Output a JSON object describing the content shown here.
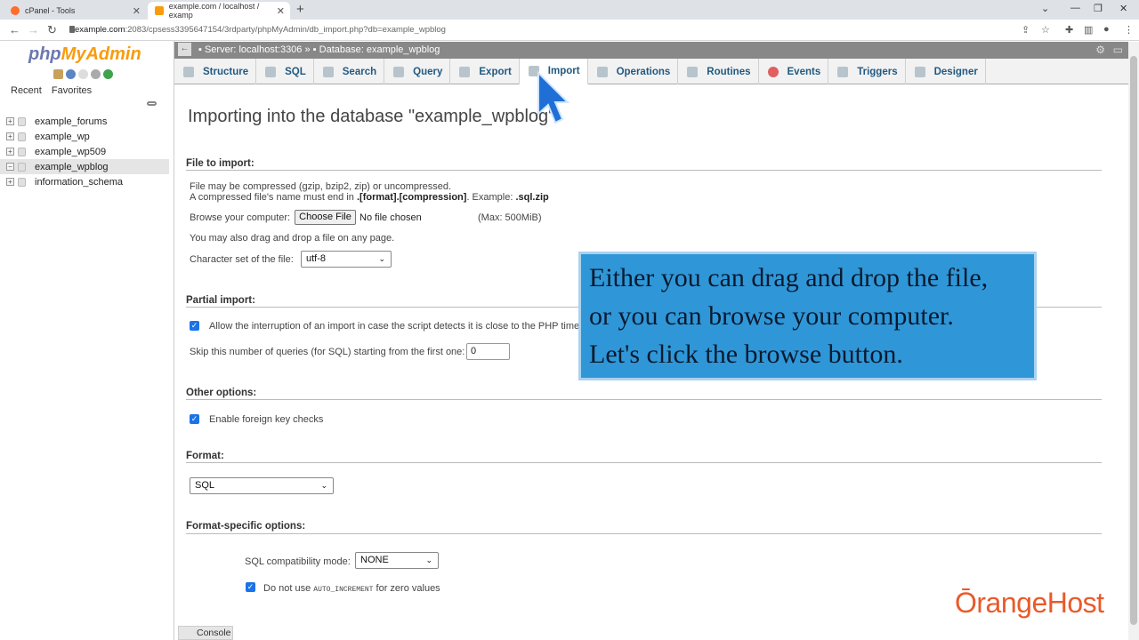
{
  "browser": {
    "tabs": [
      {
        "title": "cPanel - Tools"
      },
      {
        "title": "example.com / localhost / examp"
      }
    ],
    "url_host": "example.com",
    "url_rest": ":2083/cpsess3395647154/3rdparty/phpMyAdmin/db_import.php?db=example_wpblog"
  },
  "sidebar": {
    "logo_php": "php",
    "logo_my": "MyAdmin",
    "nav": [
      "Recent",
      "Favorites"
    ],
    "databases": [
      "example_forums",
      "example_wp",
      "example_wp509",
      "example_wpblog",
      "information_schema"
    ],
    "selected": "example_wpblog"
  },
  "breadcrumb": {
    "server": "Server: localhost:3306",
    "sep": "»",
    "database": "Database: example_wpblog"
  },
  "menu": {
    "tabs": [
      "Structure",
      "SQL",
      "Search",
      "Query",
      "Export",
      "Import",
      "Operations",
      "Routines",
      "Events",
      "Triggers",
      "Designer"
    ],
    "active": "Import"
  },
  "main": {
    "title": "Importing into the database \"example_wpblog\"",
    "file_section": {
      "heading": "File to import:",
      "line1": "File may be compressed (gzip, bzip2, zip) or uncompressed.",
      "line2_pre": "A compressed file's name must end in ",
      "line2_bold": ".[format].[compression]",
      "line2_mid": ". Example: ",
      "line2_example": ".sql.zip",
      "browse_label": "Browse your computer:",
      "choose_button": "Choose File",
      "no_file": "No file chosen",
      "max": "(Max: 500MiB)",
      "drag_hint": "You may also drag and drop a file on any page.",
      "charset_label": "Character set of the file:",
      "charset_value": "utf-8"
    },
    "partial_section": {
      "heading": "Partial import:",
      "allow_interrupt": "Allow the interruption of an import in case the script detects it is close to the PHP timeout",
      "skip_label": "Skip this number of queries (for SQL) starting from the first one:",
      "skip_value": "0"
    },
    "other_section": {
      "heading": "Other options:",
      "foreign_keys": "Enable foreign key checks"
    },
    "format_section": {
      "heading": "Format:",
      "value": "SQL"
    },
    "format_specific": {
      "heading": "Format-specific options:",
      "compat_label": "SQL compatibility mode:",
      "compat_value": "NONE",
      "auto_pre": "Do not use ",
      "auto_code": "AUTO_INCREMENT",
      "auto_post": " for zero values"
    },
    "console": "Console"
  },
  "overlay": {
    "lines": [
      "Either you can drag and drop the file,",
      "or you can browse your computer.",
      "Let's click the browse button."
    ],
    "brand": "ŌrangeHost"
  }
}
